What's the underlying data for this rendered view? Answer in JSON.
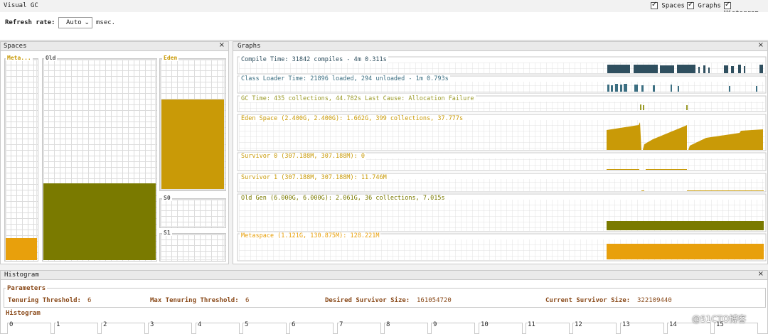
{
  "window": {
    "title": "Visual GC",
    "checks": [
      {
        "label": "Spaces",
        "checked": true
      },
      {
        "label": "Graphs",
        "checked": true
      },
      {
        "label": "Histogram",
        "checked": true
      }
    ],
    "refresh_label": "Refresh rate:",
    "refresh_value": "Auto",
    "refresh_unit": "msec."
  },
  "spaces": {
    "header": "Spaces",
    "close": "×",
    "meta_label": "Meta...",
    "old_label": "Old",
    "eden_label": "Eden",
    "s0_label": "S0",
    "s1_label": "S1",
    "meta_fill": 0.11,
    "old_fill": 0.38,
    "eden_fill": 0.68,
    "colors": {
      "meta": "#e8a00c",
      "old": "#7a7a00",
      "eden": "#c99a07",
      "label": "#c99a07"
    }
  },
  "graphs": {
    "header": "Graphs",
    "close": "×",
    "rows": [
      {
        "label": "Compile Time: 31842 compiles - 4m 0.311s",
        "color": "#2f4f5f"
      },
      {
        "label": "Class Loader Time: 21896 loaded, 294 unloaded - 1m 0.793s",
        "color": "#3c6f82"
      },
      {
        "label": "GC Time: 435 collections, 44.782s  Last Cause: Allocation Failure",
        "color": "#9a9a28"
      },
      {
        "label": "Eden Space (2.400G, 2.400G): 1.662G, 399 collections, 37.777s",
        "color": "#c99a07"
      },
      {
        "label": "Survivor 0 (307.188M, 307.188M): 0",
        "color": "#c99a07"
      },
      {
        "label": "Survivor 1 (307.188M, 307.188M): 11.746M",
        "color": "#c99a07"
      },
      {
        "label": "Old Gen (6.000G, 6.000G): 2.061G, 36 collections, 7.015s",
        "color": "#7a7a00"
      },
      {
        "label": "Metaspace (1.121G, 130.875M): 128.221M",
        "color": "#e8a00c"
      }
    ]
  },
  "histogram": {
    "header": "Histogram",
    "close": "×",
    "params_title": "Parameters",
    "tenuring_label": "Tenuring Threshold:",
    "tenuring_value": "6",
    "max_tenuring_label": "Max Tenuring Threshold:",
    "max_tenuring_value": "6",
    "desired_label": "Desired Survivor Size:",
    "desired_value": "161054720",
    "current_label": "Current Survivor Size:",
    "current_value": "322109440",
    "hist_title": "Histogram",
    "bins": [
      "0",
      "1",
      "2",
      "3",
      "4",
      "5",
      "6",
      "7",
      "8",
      "9",
      "10",
      "11",
      "12",
      "13",
      "14",
      "15"
    ]
  },
  "watermark": "@51CTO博客"
}
